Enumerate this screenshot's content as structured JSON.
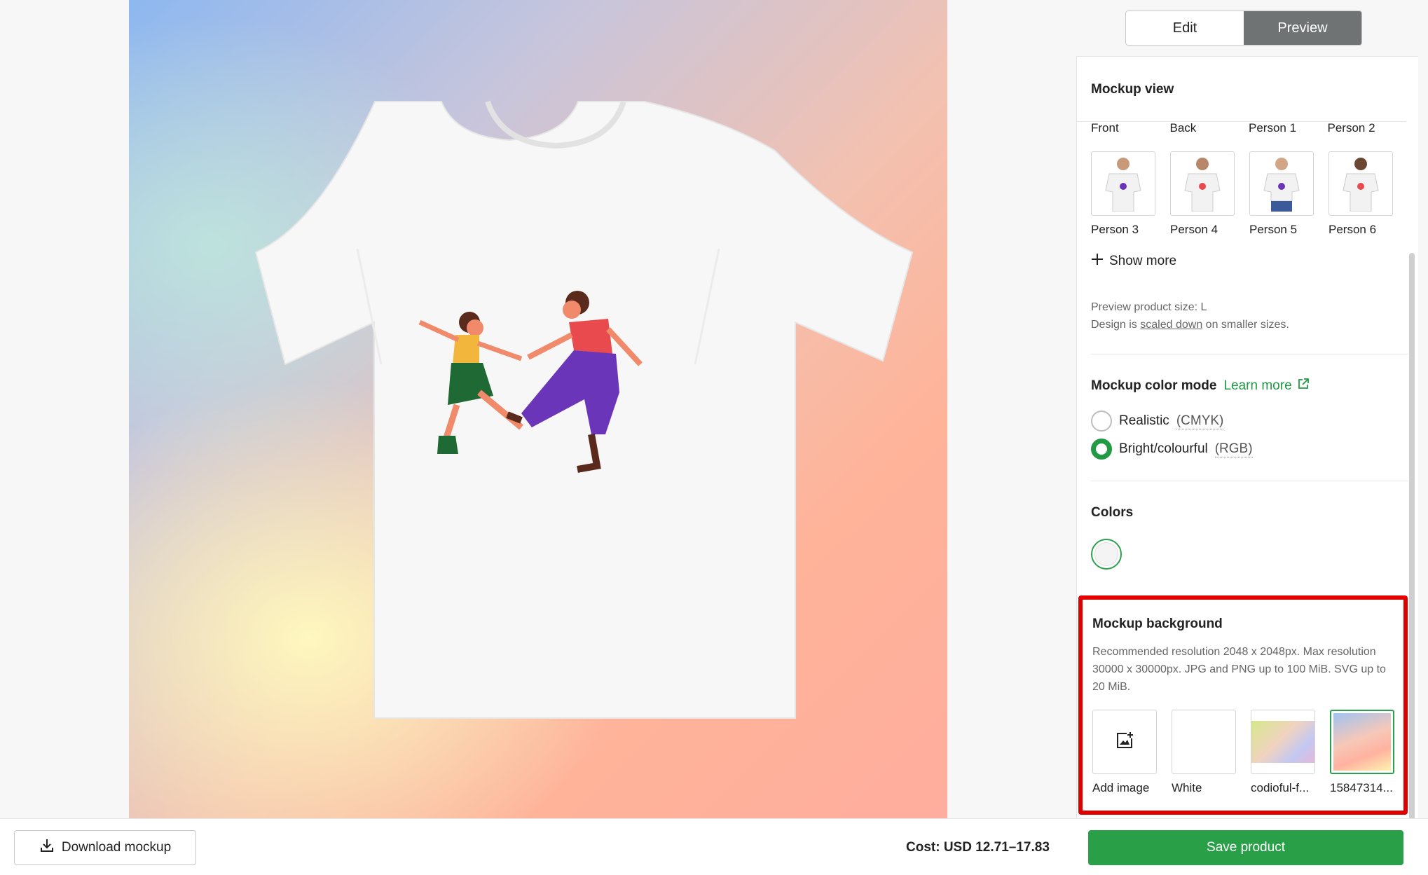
{
  "tabs": {
    "edit": "Edit",
    "preview": "Preview"
  },
  "mockup_view": {
    "title": "Mockup view",
    "top_labels": [
      "Front",
      "Back",
      "Person 1",
      "Person 2"
    ],
    "thumbs": [
      {
        "label": "Person 3"
      },
      {
        "label": "Person 4"
      },
      {
        "label": "Person 5"
      },
      {
        "label": "Person 6"
      }
    ],
    "show_more": "Show more",
    "preview_size": "Preview product size: L",
    "design_prefix": "Design is",
    "design_link": "scaled down",
    "design_suffix": "on smaller sizes."
  },
  "color_mode": {
    "title": "Mockup color mode",
    "learn_more": "Learn more",
    "options": [
      {
        "label": "Realistic",
        "note": "(CMYK)",
        "selected": false
      },
      {
        "label": "Bright/colourful",
        "note": "(RGB)",
        "selected": true
      }
    ]
  },
  "colors": {
    "title": "Colors",
    "selected": "#f4f4f4"
  },
  "background": {
    "title": "Mockup background",
    "description": "Recommended resolution 2048 x 2048px. Max resolution 30000 x 30000px. JPG and PNG up to 100 MiB. SVG up to 20 MiB.",
    "options": [
      {
        "label": "Add image"
      },
      {
        "label": "White"
      },
      {
        "label": "codioful-f..."
      },
      {
        "label": "15847314..."
      }
    ]
  },
  "footer": {
    "download": "Download mockup",
    "cost": "Cost: USD 12.71–17.83",
    "save": "Save product"
  },
  "accent_color": "#29a048"
}
